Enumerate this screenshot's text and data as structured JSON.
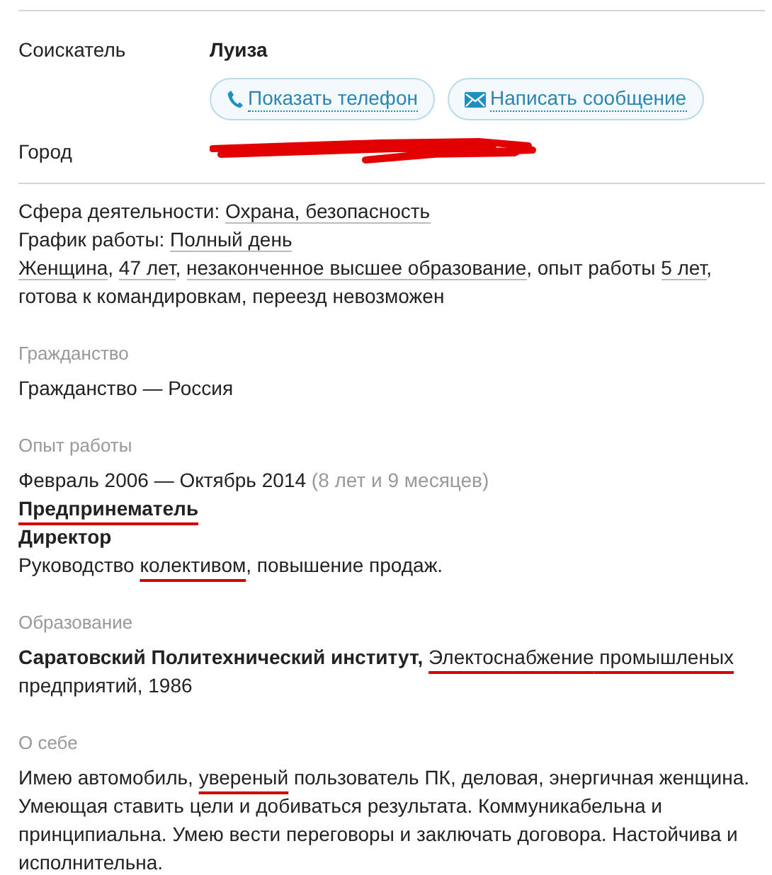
{
  "applicant": {
    "label": "Соискатель",
    "name": "Луиза",
    "buttons": [
      {
        "kind": "phone",
        "label": "Показать телефон"
      },
      {
        "kind": "message",
        "label": "Написать сообщение"
      }
    ]
  },
  "city": {
    "label": "Город"
  },
  "summary": [
    [
      {
        "kind": "plain",
        "text": "Сфера деятельности: "
      },
      {
        "kind": "link",
        "text": "Охрана, безопасность"
      }
    ],
    [
      {
        "kind": "plain",
        "text": "График работы: "
      },
      {
        "kind": "link",
        "text": "Полный день"
      }
    ],
    [
      {
        "kind": "link",
        "text": "Женщина"
      },
      {
        "kind": "plain",
        "text": ", "
      },
      {
        "kind": "link",
        "text": "47 лет"
      },
      {
        "kind": "plain",
        "text": ", "
      },
      {
        "kind": "link",
        "text": "незаконченное высшее образование"
      },
      {
        "kind": "plain",
        "text": ", опыт работы "
      },
      {
        "kind": "link",
        "text": "5 лет"
      },
      {
        "kind": "plain",
        "text": ", готова к командировкам, переезд невозможен"
      }
    ]
  ],
  "sections": [
    {
      "title": "Гражданство",
      "lines": [
        [
          {
            "kind": "plain",
            "text": "Гражданство — Россия"
          }
        ]
      ]
    },
    {
      "title": "Опыт работы",
      "lines": [
        [
          {
            "kind": "plain",
            "text": "Февраль 2006 — Октябрь 2014"
          },
          {
            "kind": "muted",
            "text": " (8 лет и 9 месяцев)"
          }
        ],
        [
          {
            "kind": "bold_marked",
            "text": "Предпринематель"
          }
        ],
        [
          {
            "kind": "bold",
            "text": "Директор"
          }
        ],
        [
          {
            "kind": "plain",
            "text": "Руководство "
          },
          {
            "kind": "marked",
            "text": "колективом"
          },
          {
            "kind": "plain",
            "text": ", повышение продаж."
          }
        ]
      ]
    },
    {
      "title": "Образование",
      "lines": [
        [
          {
            "kind": "bold",
            "text": "Саратовский Политехнический институт, "
          },
          {
            "kind": "marked",
            "text": "Электоснабжение"
          },
          {
            "kind": "marked",
            "text": " промышленых"
          },
          {
            "kind": "plain",
            "text": " предприятий, 1986"
          }
        ]
      ]
    },
    {
      "title": "О себе",
      "lines": [
        [
          {
            "kind": "plain",
            "text": "Имею автомобиль, "
          },
          {
            "kind": "marked",
            "text": "увереный"
          },
          {
            "kind": "plain",
            "text": " пользователь ПК, деловая, энергичная женщина. Умеющая ставить цели и добиваться результата. Коммуникабельна и принципиальна. Умею вести переговоры и заключать договора. Настойчива и исполнительна."
          }
        ]
      ]
    }
  ]
}
